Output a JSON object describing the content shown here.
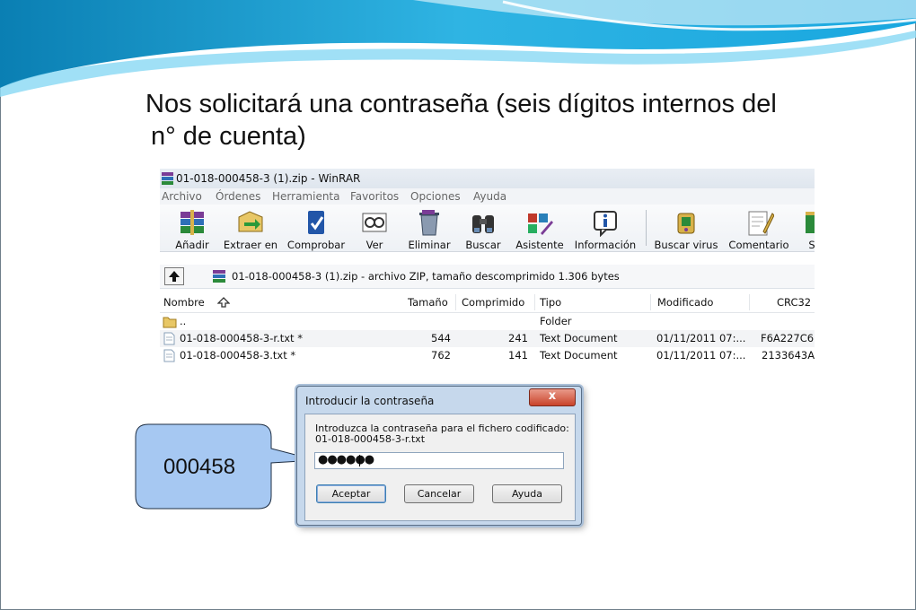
{
  "slide": {
    "title_line1": "Nos solicitará una contraseña (seis dígitos internos del",
    "title_line2": "n° de cuenta)",
    "accent_color": "#1a9fd6"
  },
  "window": {
    "title": "01-018-000458-3 (1).zip - WinRAR",
    "menu": [
      "Archivo",
      "Órdenes",
      "Herramienta",
      "Favoritos",
      "Opciones",
      "Ayuda"
    ],
    "toolbar": [
      {
        "label": "Añadir",
        "icon": "add-archive-icon"
      },
      {
        "label": "Extraer en",
        "icon": "extract-icon"
      },
      {
        "label": "Comprobar",
        "icon": "test-icon"
      },
      {
        "label": "Ver",
        "icon": "view-icon"
      },
      {
        "label": "Eliminar",
        "icon": "delete-icon"
      },
      {
        "label": "Buscar",
        "icon": "find-icon"
      },
      {
        "label": "Asistente",
        "icon": "wizard-icon"
      },
      {
        "label": "Información",
        "icon": "info-icon"
      },
      {
        "label": "Buscar virus",
        "icon": "virus-scan-icon"
      },
      {
        "label": "Comentario",
        "icon": "comment-icon"
      },
      {
        "label": "S",
        "icon": "sfx-icon"
      }
    ],
    "path": "01-018-000458-3 (1).zip - archivo ZIP, tamaño descomprimido 1.306 bytes",
    "columns": {
      "name": "Nombre",
      "size": "Tamaño",
      "packed": "Comprimido",
      "type": "Tipo",
      "modified": "Modificado",
      "crc": "CRC32"
    },
    "rows": [
      {
        "name": "..",
        "size": "",
        "packed": "",
        "type": "Folder",
        "modified": "",
        "crc": ""
      },
      {
        "name": "01-018-000458-3-r.txt *",
        "size": "544",
        "packed": "241",
        "type": "Text Document",
        "modified": "01/11/2011 07:...",
        "crc": "F6A227C6"
      },
      {
        "name": "01-018-000458-3.txt *",
        "size": "762",
        "packed": "141",
        "type": "Text Document",
        "modified": "01/11/2011 07:...",
        "crc": "2133643A"
      }
    ]
  },
  "dialog": {
    "title": "Introducir la contraseña",
    "close_label": "x",
    "message_line1": "Introduzca la contraseña para el fichero codificado:",
    "message_line2": "01-018-000458-3-r.txt",
    "password_mask": "●●●●●●",
    "buttons": {
      "accept": "Aceptar",
      "cancel": "Cancelar",
      "help": "Ayuda"
    }
  },
  "callout": {
    "text": "000458",
    "fill_color": "#a6c8f2"
  }
}
